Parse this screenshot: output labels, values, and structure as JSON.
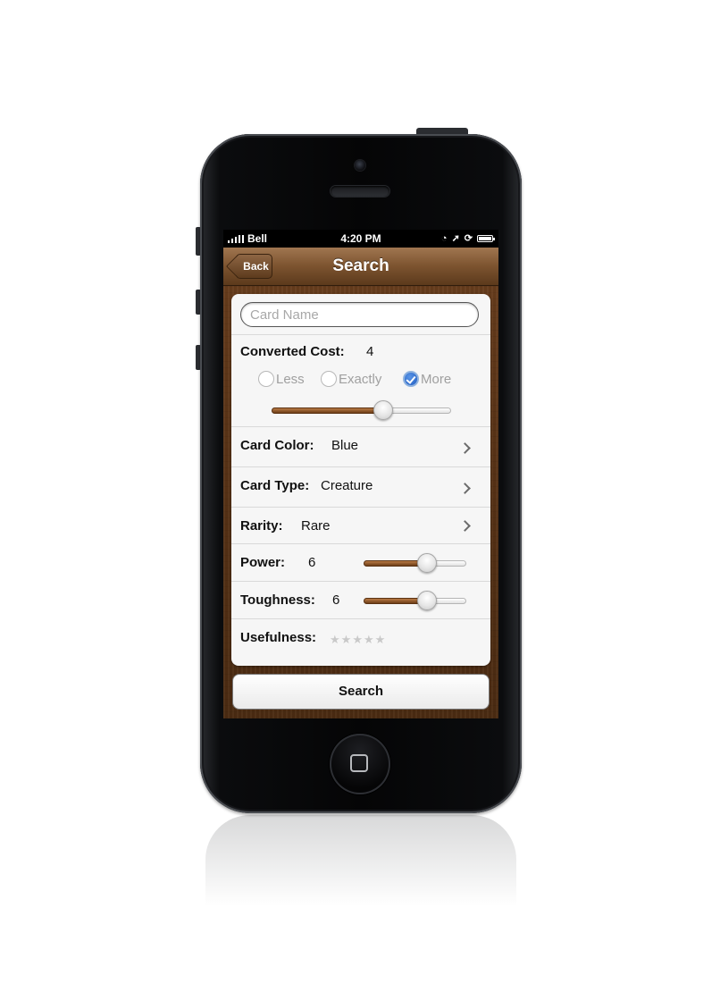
{
  "status_bar": {
    "carrier": "Bell",
    "time": "4:20 PM"
  },
  "nav": {
    "back_label": "Back",
    "title": "Search"
  },
  "form": {
    "card_name_placeholder": "Card Name",
    "converted_cost": {
      "label": "Converted Cost:",
      "value": "4",
      "options": [
        "Less",
        "Exactly",
        "More"
      ],
      "selected": "More",
      "slider_fraction": 0.62
    },
    "card_color": {
      "label": "Card Color:",
      "value": "Blue"
    },
    "card_type": {
      "label": "Card Type:",
      "value": "Creature"
    },
    "rarity": {
      "label": "Rarity:",
      "value": "Rare"
    },
    "power": {
      "label": "Power:",
      "value": "6",
      "slider_fraction": 0.62
    },
    "toughness": {
      "label": "Toughness:",
      "value": "6",
      "slider_fraction": 0.62
    },
    "usefulness": {
      "label": "Usefulness:",
      "stars_filled": 0,
      "stars_total": 5
    }
  },
  "search_button_label": "Search",
  "colors": {
    "wood": "#5a3417",
    "accent_blue": "#2f6fd4",
    "slider_fill": "#8b5326"
  }
}
